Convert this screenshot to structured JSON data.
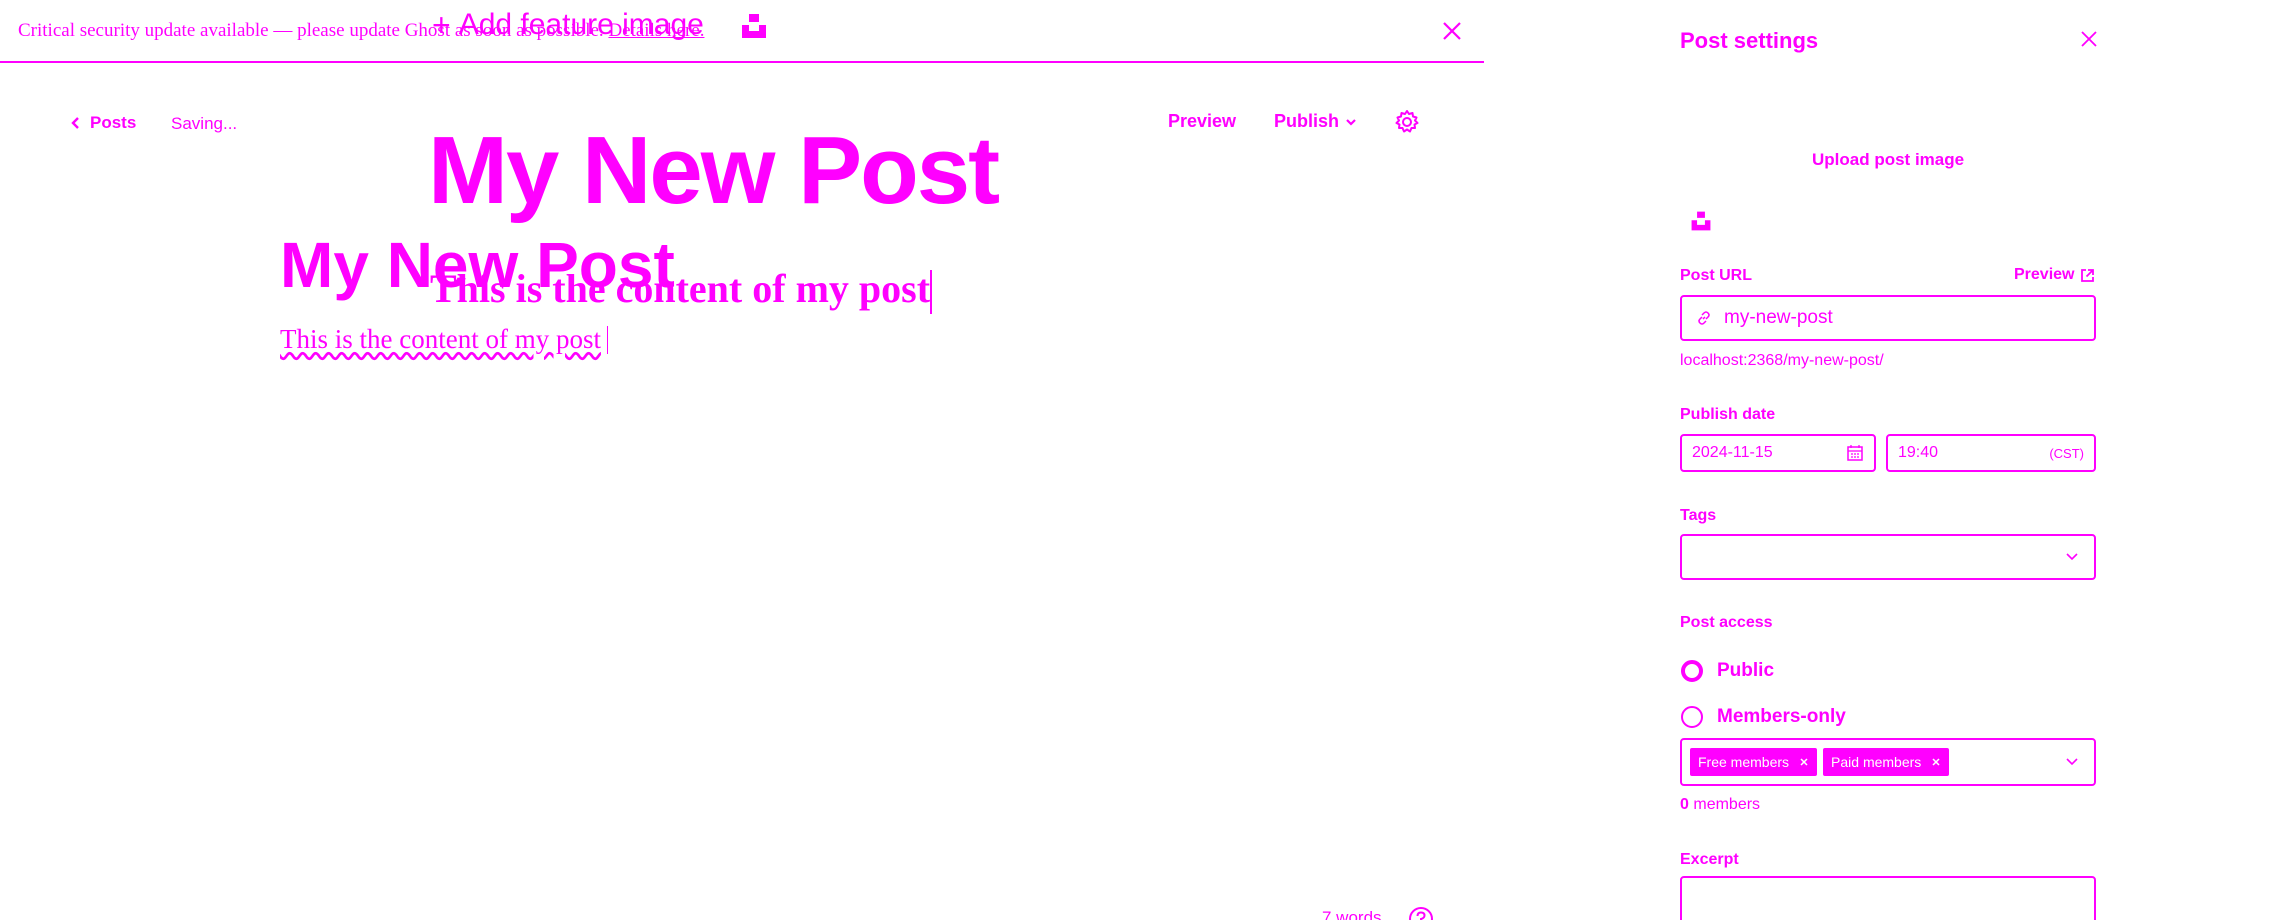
{
  "banner": {
    "text": "Critical security update available — please update Ghost as soon as possible.",
    "link": "Details here."
  },
  "feature_image": {
    "label": "Add feature image",
    "plus": "+"
  },
  "toolbar": {
    "back_label": "Posts",
    "status": "Saving...",
    "preview_label": "Preview",
    "publish_label": "Publish"
  },
  "editor": {
    "title": "My New Post",
    "content": "This is the content of my post",
    "word_count": "7 words"
  },
  "settings": {
    "title": "Post settings",
    "upload_image": "Upload post image",
    "post_url": {
      "label": "Post URL",
      "preview_label": "Preview",
      "value": "my-new-post",
      "full_url": "localhost:2368/my-new-post/"
    },
    "publish_date": {
      "label": "Publish date",
      "date": "2024-11-15",
      "time": "19:40",
      "timezone": "(CST)"
    },
    "tags": {
      "label": "Tags"
    },
    "access": {
      "label": "Post access",
      "options": [
        "Public",
        "Members-only"
      ],
      "selected": "Public",
      "tiers": [
        "Free members",
        "Paid members"
      ],
      "member_count": "0",
      "member_suffix": "members"
    },
    "excerpt": {
      "label": "Excerpt"
    }
  },
  "colors": {
    "accent": "#ff00ff",
    "background": "#ffffff"
  },
  "icons": [
    "close-icon",
    "chevron-left-icon",
    "chevron-down-icon",
    "gear-icon",
    "unsplash-icon",
    "link-icon",
    "external-link-icon",
    "calendar-icon",
    "help-icon"
  ]
}
